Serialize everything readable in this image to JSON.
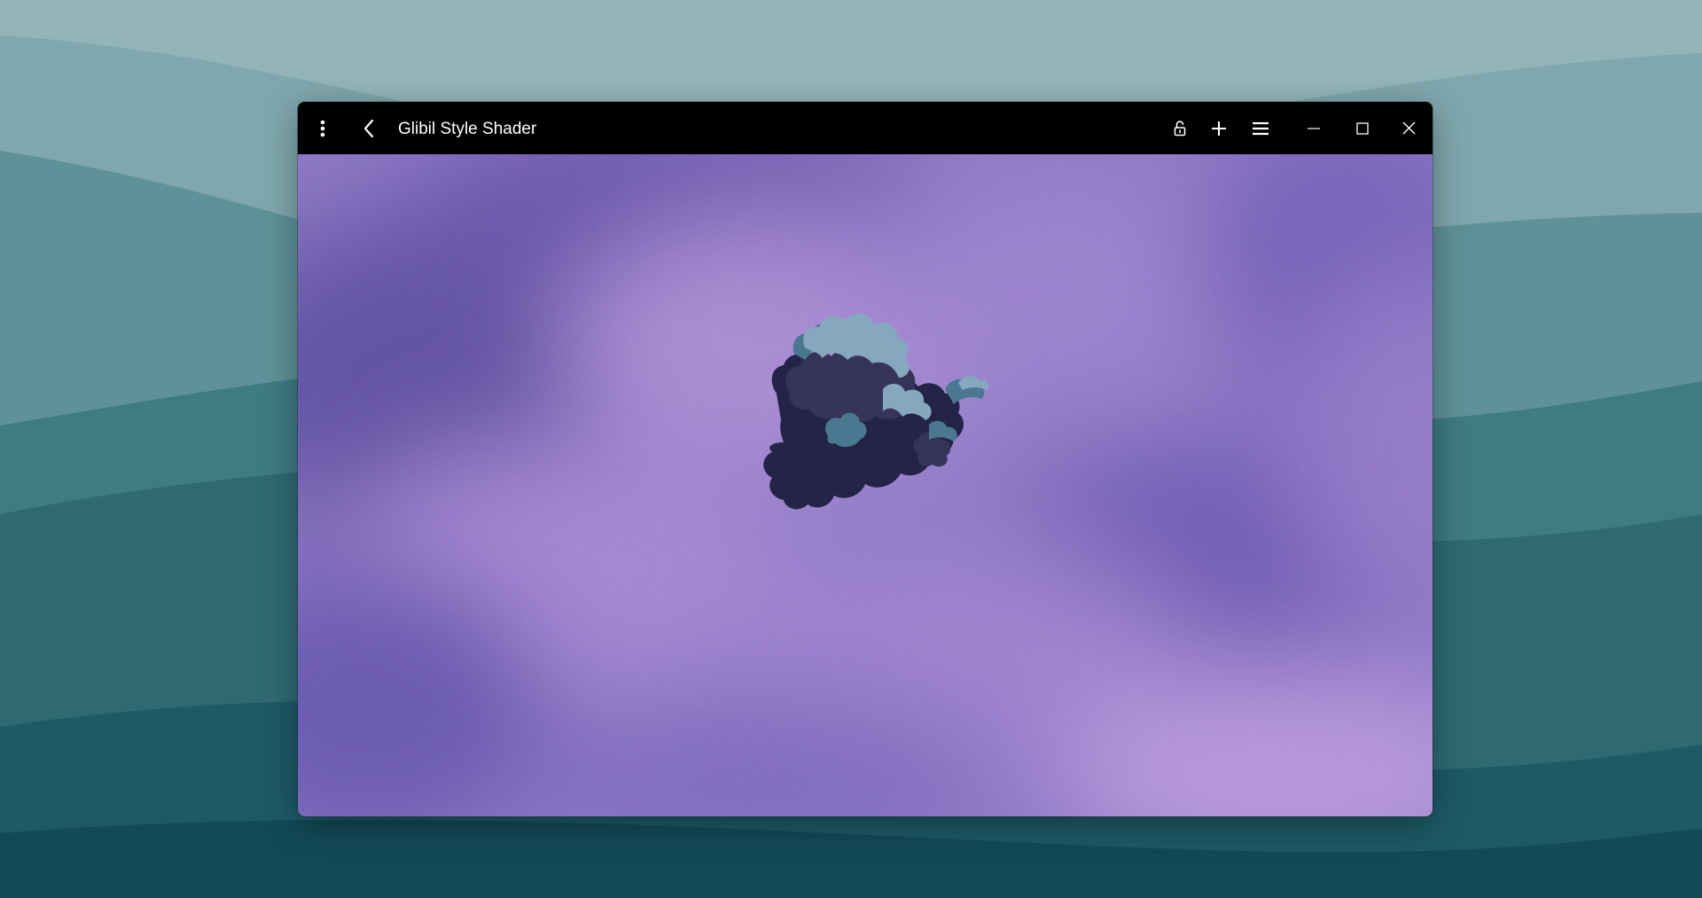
{
  "window": {
    "title": "Glibil Style Shader"
  },
  "titlebar": {
    "buttons": [
      {
        "name": "more-options",
        "icon": "vertical-ellipsis-icon"
      },
      {
        "name": "back",
        "icon": "chevron-left-icon"
      },
      {
        "name": "lock",
        "icon": "unlock-icon"
      },
      {
        "name": "add",
        "icon": "plus-icon"
      },
      {
        "name": "menu",
        "icon": "hamburger-menu-icon"
      },
      {
        "name": "minimize",
        "icon": "minimize-icon"
      },
      {
        "name": "maximize",
        "icon": "maximize-icon"
      },
      {
        "name": "close",
        "icon": "close-icon"
      }
    ]
  },
  "colors": {
    "titlebar_bg": "#000000",
    "sky_base": "#8a74c4",
    "sky_dark": "#5d4fa0",
    "sky_light": "#b48fd6",
    "cloud_light": "#86a8bf",
    "cloud_mid": "#4a7891",
    "cloud_dark": "#37345a",
    "cloud_darkest": "#232447",
    "desktop_teal": "#1f5360"
  }
}
